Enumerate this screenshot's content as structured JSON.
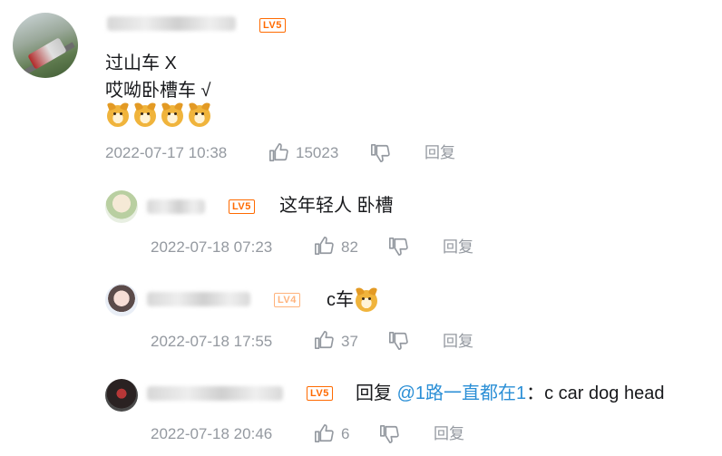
{
  "main_comment": {
    "level": "LV5",
    "level_color": "#ff6a00",
    "lines": [
      "过山车   X",
      "哎呦卧槽车  √"
    ],
    "emojis": [
      "doge-emoji",
      "doge-emoji",
      "doge-emoji",
      "doge-emoji"
    ],
    "timestamp": "2022-07-17 10:38",
    "likes": "15023",
    "reply_label": "回复"
  },
  "replies": [
    {
      "level": "LV5",
      "level_color": "#ff6a00",
      "text": "这年轻人  卧槽",
      "timestamp": "2022-07-18 07:23",
      "likes": "82",
      "reply_label": "回复"
    },
    {
      "level": "LV4",
      "level_color": "#ffb37c",
      "text": "c车",
      "timestamp": "2022-07-18 17:55",
      "likes": "37",
      "reply_label": "回复"
    },
    {
      "level": "LV5",
      "level_color": "#ff6a00",
      "reply_prefix": "回复 ",
      "mention": "@1路一直都在1",
      "text": "：c car dog head",
      "timestamp": "2022-07-18 20:46",
      "likes": "6",
      "reply_label": "回复"
    }
  ],
  "colors": {
    "meta_text": "#9499a0",
    "mention": "#2b8fd6"
  }
}
